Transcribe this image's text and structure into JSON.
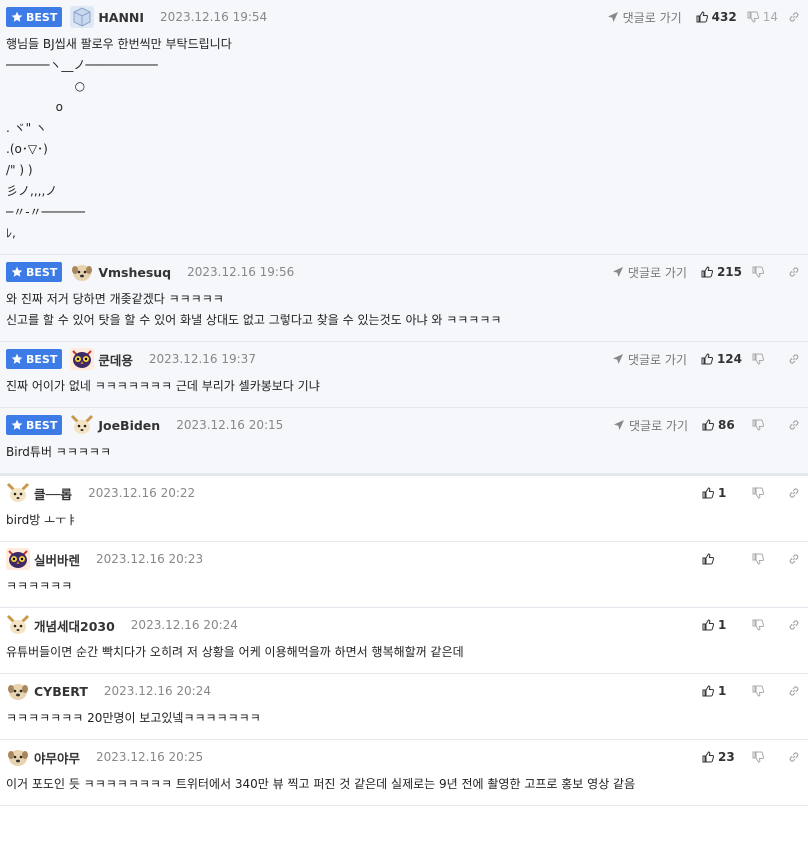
{
  "ui": {
    "best_label": "BEST",
    "goto_label": "댓글로 가기"
  },
  "comments": [
    {
      "best": true,
      "nick": "HANNI",
      "time": "2023.12.16 19:54",
      "likes": "432",
      "dislikes": "14",
      "body": "행님들 BJ씹새 팔로우 한번씩만 부탁드립니다\n──────ヽ__ノ──────────\n                  ○\n             ο\n. ヾ\" ヽ\n.(ο･▽･)\n/\" ) )\n彡ノ,,,,ノ\n─〃-〃──────\nﾚ,"
    },
    {
      "best": true,
      "nick": "Vmshesuq",
      "time": "2023.12.16 19:56",
      "likes": "215",
      "dislikes": "",
      "body": "와 진짜 저거 당하면 개좆같겠다 ㅋㅋㅋㅋㅋ\n신고를 할 수 있어 탓을 할 수 있어 화낼 상대도 없고 그렇다고 찾을 수 있는것도 아냐 와 ㅋㅋㅋㅋㅋ"
    },
    {
      "best": true,
      "nick": "쿤데용",
      "time": "2023.12.16 19:37",
      "likes": "124",
      "dislikes": "",
      "body": "진짜 어이가 없네 ㅋㅋㅋㅋㅋㅋㅋ 근데 부리가 셀카봉보다 기냐"
    },
    {
      "best": true,
      "nick": "JoeBiden",
      "time": "2023.12.16 20:15",
      "likes": "86",
      "dislikes": "",
      "body": "Bird튜버 ㅋㅋㅋㅋㅋ"
    },
    {
      "best": false,
      "nick": "클──롭",
      "time": "2023.12.16 20:22",
      "likes": "1",
      "dislikes": "",
      "body": "bird방 ㅗㅜㅑ"
    },
    {
      "best": false,
      "nick": "실버바렌",
      "time": "2023.12.16 20:23",
      "likes": "",
      "dislikes": "",
      "body": "ㅋㅋㅋㅋㅋㅋ"
    },
    {
      "best": false,
      "nick": "개념세대2030",
      "time": "2023.12.16 20:24",
      "likes": "1",
      "dislikes": "",
      "body": "유튜버들이면 순간 빡치다가 오히려 저 상황을 어케 이용해먹을까 하면서 행복해할꺼 같은데"
    },
    {
      "best": false,
      "nick": "CYBERT",
      "time": "2023.12.16 20:24",
      "likes": "1",
      "dislikes": "",
      "body": "ㅋㅋㅋㅋㅋㅋㅋ 20만명이 보고있넼ㅋㅋㅋㅋㅋㅋㅋ"
    },
    {
      "best": false,
      "nick": "야무야무",
      "time": "2023.12.16 20:25",
      "likes": "23",
      "dislikes": "",
      "body": "이거 포도인 듯 ㅋㅋㅋㅋㅋㅋㅋㅋ 트위터에서 340만 뷰 찍고 퍼진 것 같은데 실제로는 9년 전에 촬영한 고프로 홍보 영상 같음"
    }
  ],
  "avatars": [
    "cube-avatar",
    "puppy-avatar",
    "owl-avatar",
    "fox-avatar",
    "fox-avatar",
    "owl-avatar",
    "fox-avatar",
    "puppy-avatar",
    "puppy-avatar"
  ],
  "colors": {
    "accent": "#3d7be6",
    "best_bg": "#f5f7fb"
  }
}
